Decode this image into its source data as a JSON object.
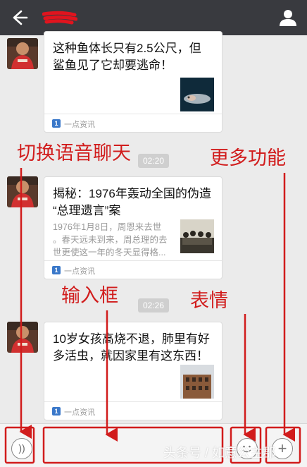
{
  "messages": [
    {
      "title": "这种鱼体长只有2.5公尺，但鲨鱼见了它却要逃命！",
      "title_lines": [
        "这种鱼体长只有2.5公尺，但",
        "鲨鱼见了它却要逃命！"
      ],
      "source": "一点资讯"
    },
    {
      "timestamp": "02:20",
      "title": "揭秘：1976年轰动全国的伪造“总理遗言”案",
      "title_lines": [
        "揭秘：1976年轰动全国的伪造",
        "“总理遗言”案"
      ],
      "desc_lines": [
        "1976年1月8日，周恩来去世",
        "。春天远未到来，周总理的去",
        "世更使这一年的冬天显得格..."
      ],
      "source": "一点资讯"
    },
    {
      "timestamp": "02:26",
      "title": "10岁女孩高烧不退，肺里有好多活虫，就因家里有这东西！",
      "title_lines": [
        "10岁女孩高烧不退，肺里有好",
        "多活虫，就因家里有这东西！"
      ],
      "source": "一点资讯"
    }
  ],
  "annotations": {
    "voice": "切换语音聊天",
    "more": "更多功能",
    "input": "输入框",
    "emoji": "表情"
  },
  "watermark": "头条号 / 如意公主郡",
  "colors": {
    "annotation": "#d11c1c",
    "topbar": "#393a3f",
    "source_icon": "#3a78c9"
  }
}
